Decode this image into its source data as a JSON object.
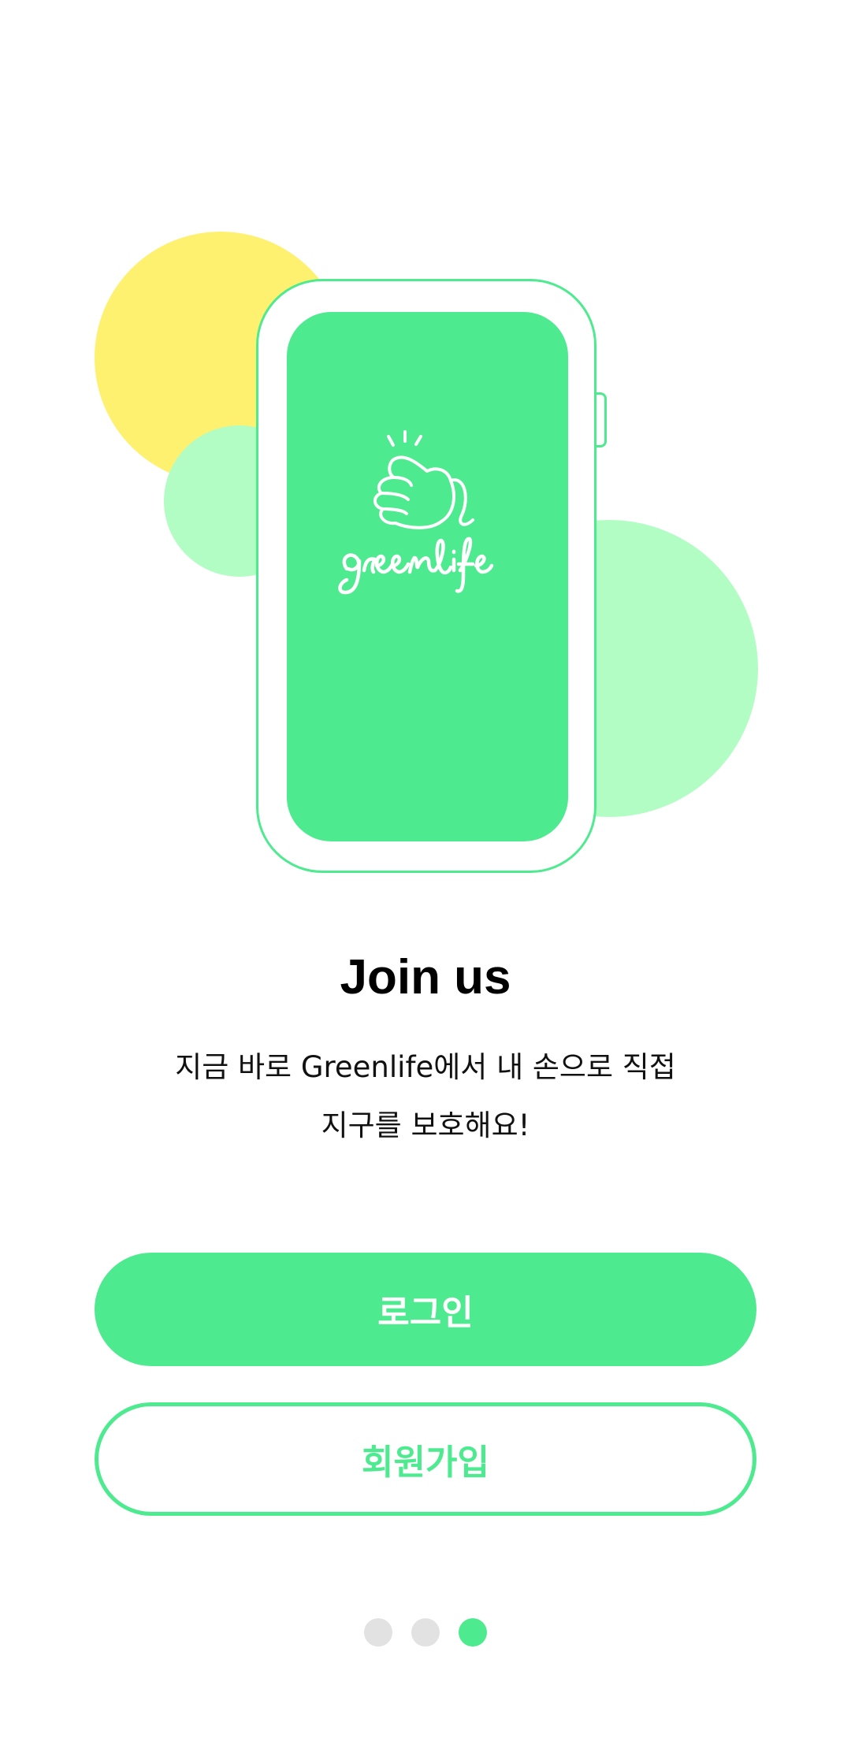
{
  "colors": {
    "primary": "#4eea8f",
    "yellow": "#fff170",
    "mint": "#b1fdc3",
    "dot_inactive": "#e2e2e2"
  },
  "illustration": {
    "logo_text": "greenlife",
    "logo_icon": "thumbs-up-icon"
  },
  "onboarding": {
    "title": "Join us",
    "description_line1": "지금 바로 Greenlife에서 내 손으로 직접",
    "description_line2": "지구를 보호해요!"
  },
  "buttons": {
    "login_label": "로그인",
    "signup_label": "회원가입"
  },
  "pager": {
    "total": 3,
    "current": 3
  }
}
